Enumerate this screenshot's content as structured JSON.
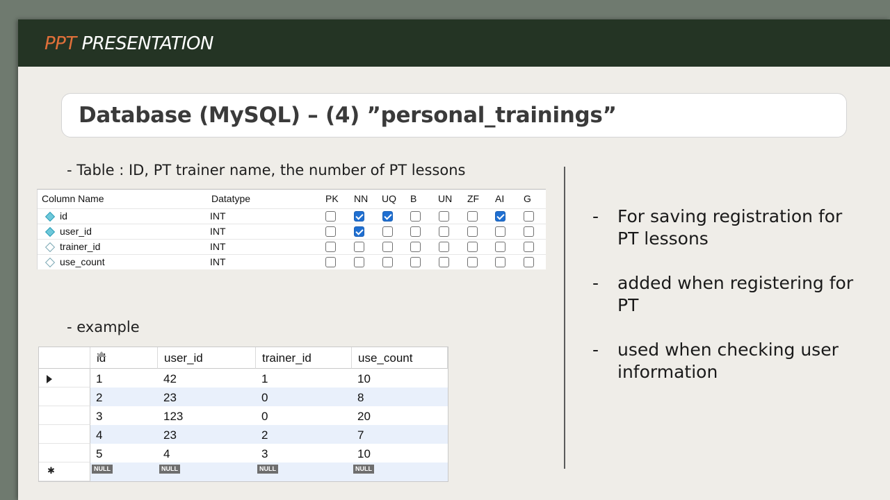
{
  "header": {
    "brand_accent": "PPT",
    "brand_rest": " PRESENTATION"
  },
  "title": "Database (MySQL) – (4) ”personal_trainings”",
  "table_caption": "- Table : ID, PT trainer name, the number of PT lessons",
  "example_caption": "- example",
  "schema": {
    "headers": [
      "Column Name",
      "Datatype",
      "PK",
      "NN",
      "UQ",
      "B",
      "UN",
      "ZF",
      "AI",
      "G"
    ],
    "rows": [
      {
        "name": "id",
        "type": "INT",
        "icon": "filled",
        "flags": [
          false,
          true,
          true,
          false,
          false,
          false,
          true,
          false
        ]
      },
      {
        "name": "user_id",
        "type": "INT",
        "icon": "filled",
        "flags": [
          false,
          true,
          false,
          false,
          false,
          false,
          false,
          false
        ]
      },
      {
        "name": "trainer_id",
        "type": "INT",
        "icon": "hollow",
        "flags": [
          false,
          false,
          false,
          false,
          false,
          false,
          false,
          false
        ]
      },
      {
        "name": "use_count",
        "type": "INT",
        "icon": "hollow",
        "flags": [
          false,
          false,
          false,
          false,
          false,
          false,
          false,
          false
        ]
      }
    ]
  },
  "example": {
    "columns": [
      "id",
      "user_id",
      "trainer_id",
      "use_count"
    ],
    "rows": [
      [
        "1",
        "42",
        "1",
        "10"
      ],
      [
        "2",
        "23",
        "0",
        "8"
      ],
      [
        "3",
        "123",
        "0",
        "20"
      ],
      [
        "4",
        "23",
        "2",
        "7"
      ],
      [
        "5",
        "4",
        "3",
        "10"
      ]
    ],
    "null_label": "NULL"
  },
  "bullets": [
    "For saving registration for PT lessons",
    "added when registering for PT",
    "used when checking user information"
  ],
  "bullet_marker": "-",
  "colors": {
    "header_bg": "#243424",
    "accent": "#e1703a",
    "slide_bg": "#efede8",
    "checkbox_on": "#1f6fd1"
  }
}
